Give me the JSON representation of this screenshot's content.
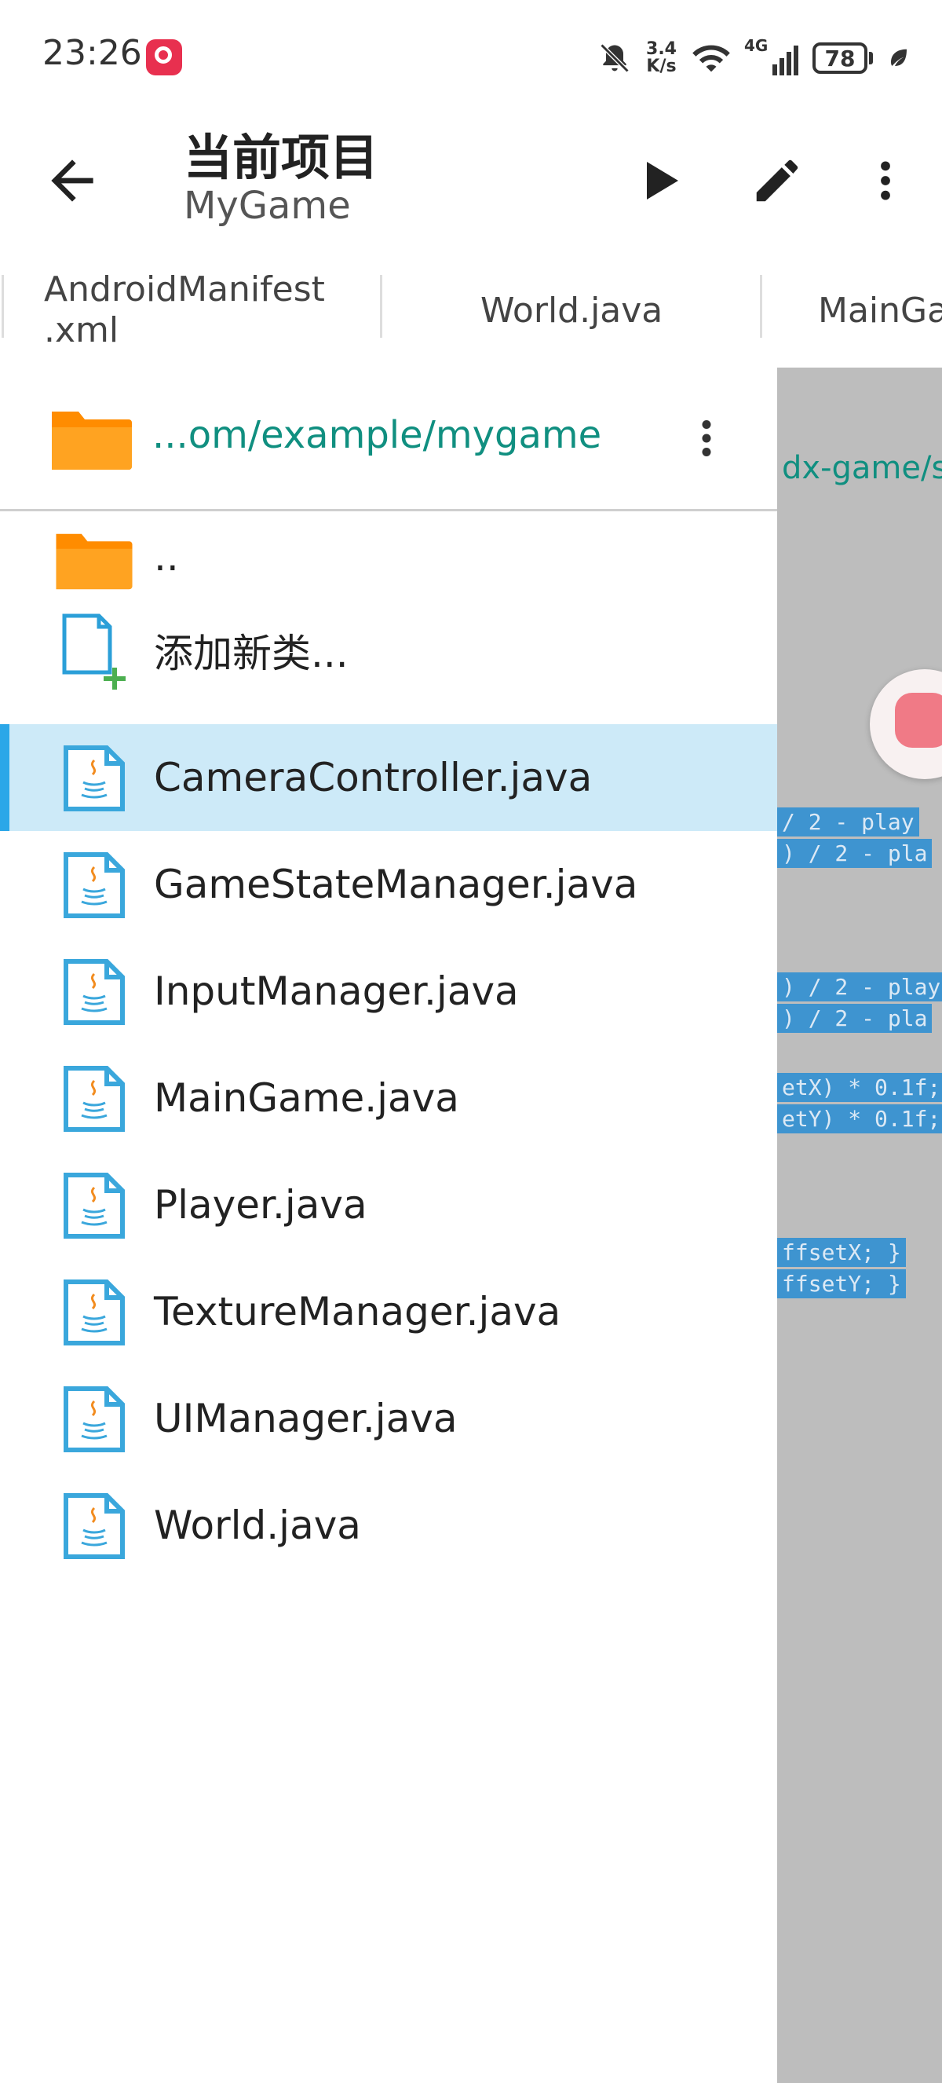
{
  "status_bar": {
    "time": "23:26",
    "speed_value": "3.4",
    "speed_unit": "K/s",
    "network": "4G",
    "battery": "78"
  },
  "app_bar": {
    "title": "当前项目",
    "subtitle": "MyGame"
  },
  "tabs": [
    {
      "line1": "AndroidManifest",
      "line2": ".xml"
    },
    {
      "label": "World.java"
    },
    {
      "label": "MainGa"
    }
  ],
  "editor": {
    "path": "dx-game/s",
    "code_lines": [
      "/ 2 - play",
      ") / 2 - pla",
      ") / 2 - play",
      ") / 2 - pla",
      "etX) * 0.1f;",
      "etY) * 0.1f;",
      "ffsetX; }",
      "ffsetY; }"
    ]
  },
  "drawer": {
    "path": "...om/example/mygame",
    "parent_dir": "..",
    "add_class": "添加新类...",
    "files": [
      {
        "name": "CameraController.java",
        "selected": true
      },
      {
        "name": "GameStateManager.java",
        "selected": false
      },
      {
        "name": "InputManager.java",
        "selected": false
      },
      {
        "name": "MainGame.java",
        "selected": false
      },
      {
        "name": "Player.java",
        "selected": false
      },
      {
        "name": "TextureManager.java",
        "selected": false
      },
      {
        "name": "UIManager.java",
        "selected": false
      },
      {
        "name": "World.java",
        "selected": false
      }
    ]
  },
  "colors": {
    "accent_teal": "#108f80",
    "folder_orange": "#ff8c00",
    "selection": "#cdeaf8",
    "selection_bar": "#2ba7e8",
    "java_icon_blue": "#3aa7dc"
  }
}
